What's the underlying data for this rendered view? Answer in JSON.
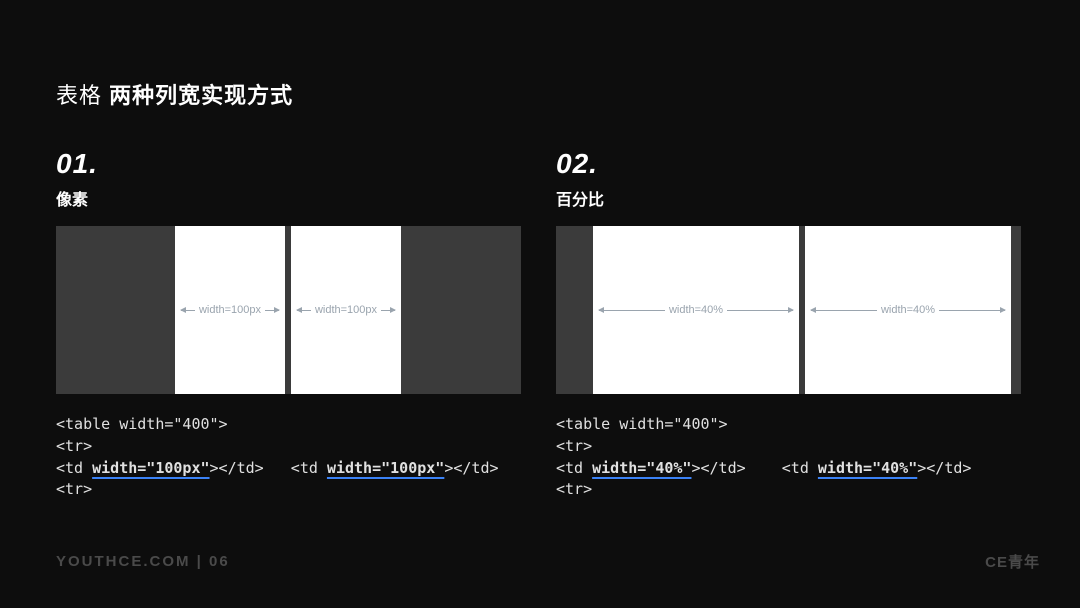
{
  "header": {
    "light": "表格 ",
    "bold": "两种列宽实现方式"
  },
  "left": {
    "num": "01.",
    "subtitle": "像素",
    "box1_label": "width=100px",
    "box2_label": "width=100px",
    "code": {
      "l1": "<table width=\"400\">",
      "l2": "<tr>",
      "l3a": "<td ",
      "l3u1": "width=\"100px\"",
      "l3b": "></td>   <td ",
      "l3u2": "width=\"100px\"",
      "l3c": "></td>",
      "l4": "<tr>"
    }
  },
  "right": {
    "num": "02.",
    "subtitle": "百分比",
    "box1_label": "width=40%",
    "box2_label": "width=40%",
    "code": {
      "l1": "<table width=\"400\">",
      "l2": "<tr>",
      "l3a": "<td ",
      "l3u1": "width=\"40%\"",
      "l3b": "></td>    <td ",
      "l3u2": "width=\"40%\"",
      "l3c": "></td>",
      "l4": "<tr>"
    }
  },
  "footer": {
    "site": "YOUTHCE.COM",
    "sep": " | ",
    "page": "06",
    "brand": "CE青年"
  }
}
